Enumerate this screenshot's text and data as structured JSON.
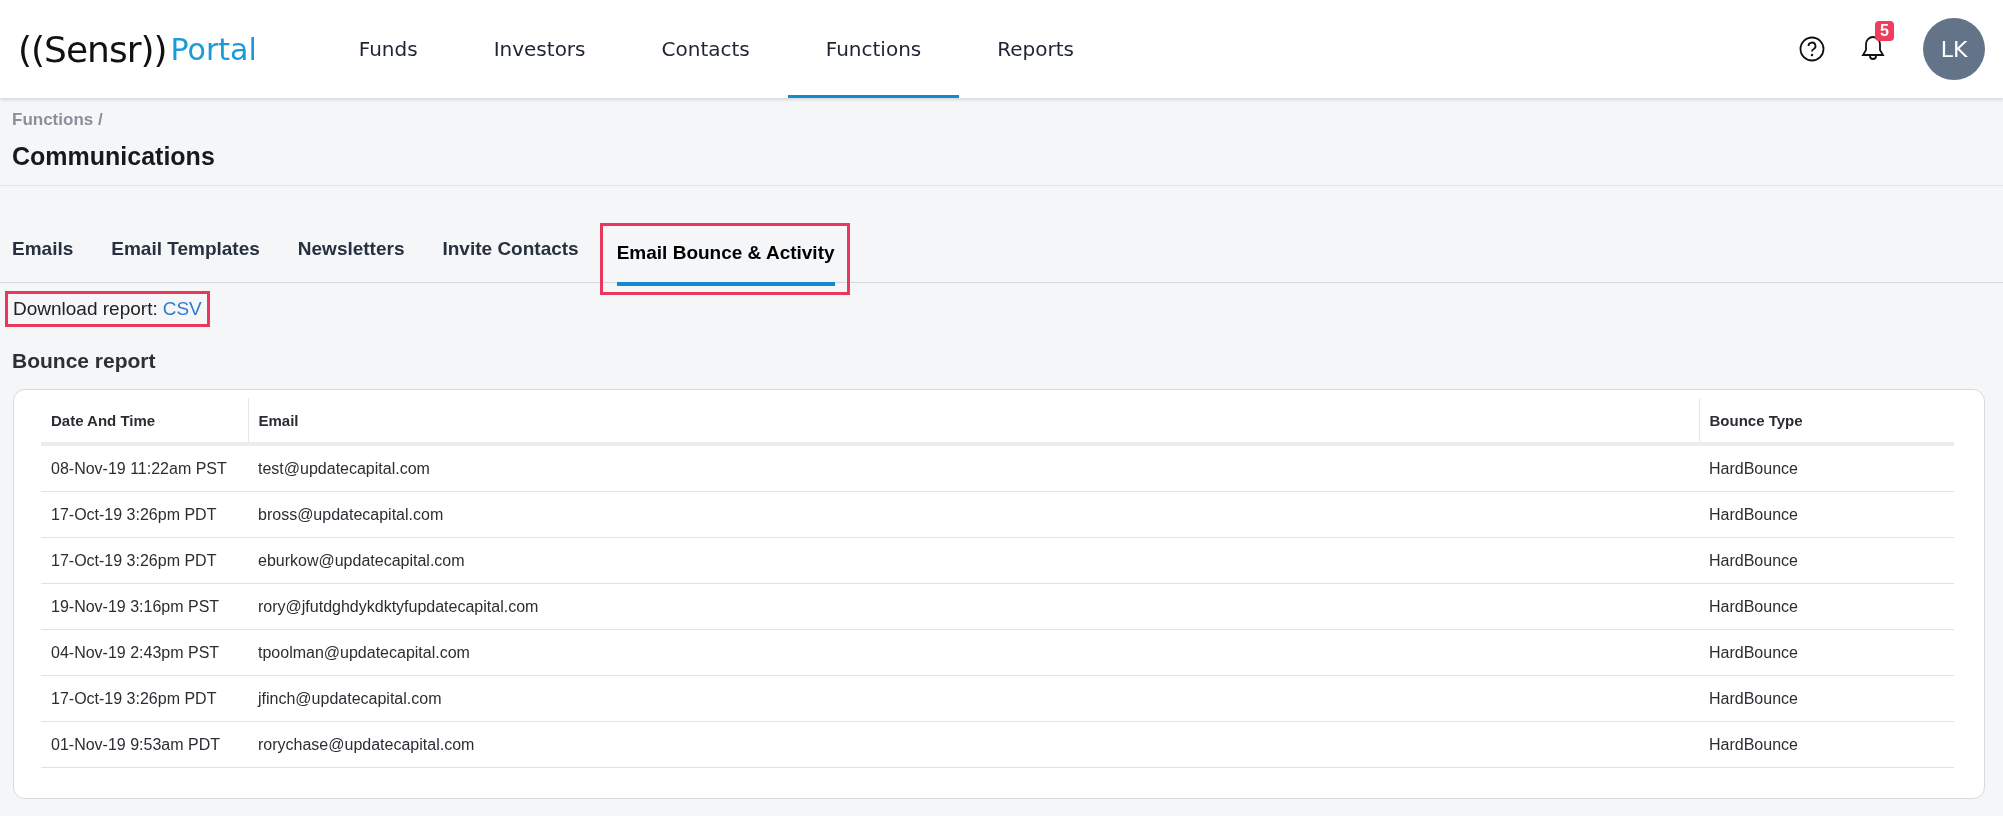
{
  "header": {
    "logo": {
      "brand": "((Sensr))",
      "product": "Portal"
    },
    "nav": [
      {
        "label": "Funds",
        "selected": false
      },
      {
        "label": "Investors",
        "selected": false
      },
      {
        "label": "Contacts",
        "selected": false
      },
      {
        "label": "Functions",
        "selected": true
      },
      {
        "label": "Reports",
        "selected": false
      }
    ],
    "notifications": {
      "count": "5"
    },
    "avatar": {
      "initials": "LK"
    }
  },
  "breadcrumb": "Functions /",
  "page_title": "Communications",
  "tabs": [
    {
      "label": "Emails",
      "selected": false,
      "highlighted": false
    },
    {
      "label": "Email Templates",
      "selected": false,
      "highlighted": false
    },
    {
      "label": "Newsletters",
      "selected": false,
      "highlighted": false
    },
    {
      "label": "Invite Contacts",
      "selected": false,
      "highlighted": false
    },
    {
      "label": "Email Bounce & Activity",
      "selected": true,
      "highlighted": true
    }
  ],
  "download": {
    "label": "Download report:",
    "link": "CSV",
    "highlighted": true
  },
  "section_title": "Bounce report",
  "table": {
    "columns": [
      "Date And Time",
      "Email",
      "Bounce Type"
    ],
    "rows": [
      [
        "08-Nov-19 11:22am PST",
        "test@updatecapital.com",
        "HardBounce"
      ],
      [
        "17-Oct-19 3:26pm PDT",
        "bross@updatecapital.com",
        "HardBounce"
      ],
      [
        "17-Oct-19 3:26pm PDT",
        "eburkow@updatecapital.com",
        "HardBounce"
      ],
      [
        "19-Nov-19 3:16pm PST",
        "rory@jfutdghdykdktyfupdatecapital.com",
        "HardBounce"
      ],
      [
        "04-Nov-19 2:43pm PST",
        "tpoolman@updatecapital.com",
        "HardBounce"
      ],
      [
        "17-Oct-19 3:26pm PDT",
        "jfinch@updatecapital.com",
        "HardBounce"
      ],
      [
        "01-Nov-19 9:53am PDT",
        "rorychase@updatecapital.com",
        "HardBounce"
      ]
    ]
  }
}
